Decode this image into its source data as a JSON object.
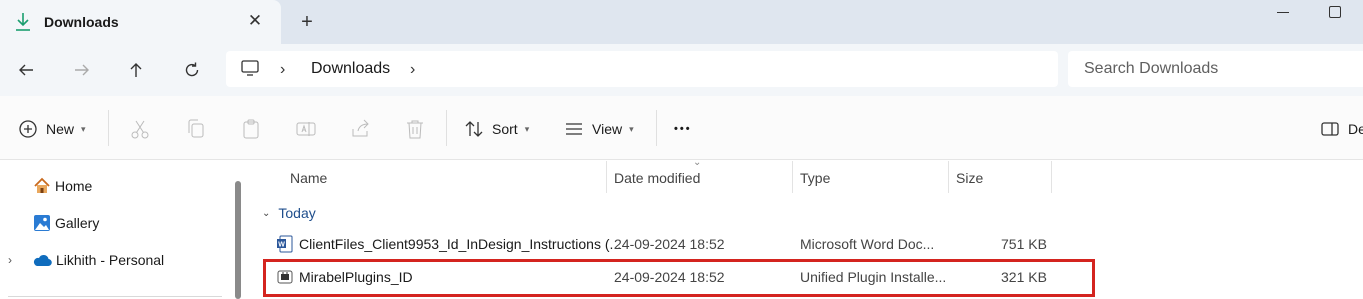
{
  "tab": {
    "title": "Downloads",
    "close": "✕",
    "new_tab": "+"
  },
  "nav": {
    "back": "←",
    "forward": "→",
    "up": "↑",
    "refresh": "↻",
    "breadcrumb": [
      "Downloads"
    ],
    "search_placeholder": "Search Downloads"
  },
  "toolbar": {
    "new_label": "New",
    "sort_label": "Sort",
    "view_label": "View",
    "more": "•••",
    "details_label": "De"
  },
  "sidebar": {
    "items": [
      {
        "label": "Home",
        "icon": "home-icon"
      },
      {
        "label": "Gallery",
        "icon": "gallery-icon"
      },
      {
        "label": "Likhith - Personal",
        "icon": "onedrive-icon"
      }
    ]
  },
  "table": {
    "columns": [
      "Name",
      "Date modified",
      "Type",
      "Size"
    ],
    "group": "Today",
    "rows": [
      {
        "name": "ClientFiles_Client9953_Id_InDesign_Instructions (...",
        "date": "24-09-2024 18:52",
        "type": "Microsoft Word Doc...",
        "size": "751 KB",
        "icon": "word-doc-icon"
      },
      {
        "name": "MirabelPlugins_ID",
        "date": "24-09-2024 18:52",
        "type": "Unified Plugin Installe...",
        "size": "321 KB",
        "icon": "plugin-installer-icon"
      }
    ]
  },
  "colors": {
    "accent": "#1f4e8c",
    "highlight": "#d4241f",
    "download_green": "#1a9e6f"
  }
}
